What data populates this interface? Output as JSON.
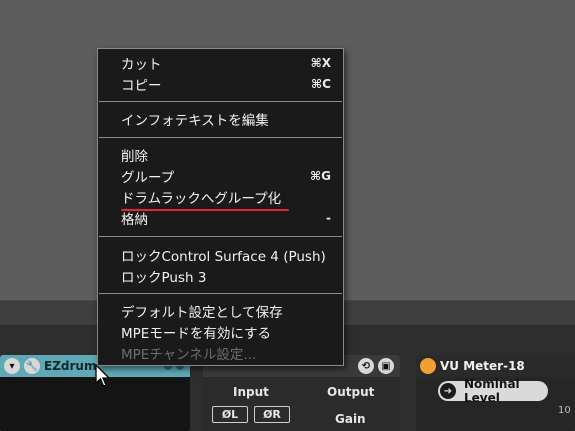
{
  "context_menu": {
    "items": [
      {
        "label": "カット",
        "shortcut": "⌘X"
      },
      {
        "label": "コピー",
        "shortcut": "⌘C"
      },
      {
        "label": "インフォテキストを編集",
        "shortcut": ""
      },
      {
        "label": "削除",
        "shortcut": ""
      },
      {
        "label": "グループ",
        "shortcut": "⌘G"
      },
      {
        "label": "ドラムラックへグループ化",
        "shortcut": ""
      },
      {
        "label": "格納",
        "shortcut": "-"
      },
      {
        "label": "ロックControl Surface 4 (Push)",
        "shortcut": ""
      },
      {
        "label": "ロックPush 3",
        "shortcut": ""
      },
      {
        "label": "デフォルト設定として保存",
        "shortcut": ""
      },
      {
        "label": "MPEモードを有効にする",
        "shortcut": ""
      },
      {
        "label": "MPEチャンネル設定...",
        "shortcut": ""
      }
    ],
    "annotation_color": "#e52535"
  },
  "devices": {
    "ezdrummer": {
      "name": "EZdrum"
    },
    "utility": {
      "input_label": "Input",
      "output_label": "Output",
      "phase_left": "ØL",
      "phase_right": "ØR",
      "gain_label": "Gain"
    },
    "vu_meter": {
      "name": "VU Meter-18",
      "nominal_level_label": "Nominal Level",
      "value_partial": "10"
    }
  }
}
